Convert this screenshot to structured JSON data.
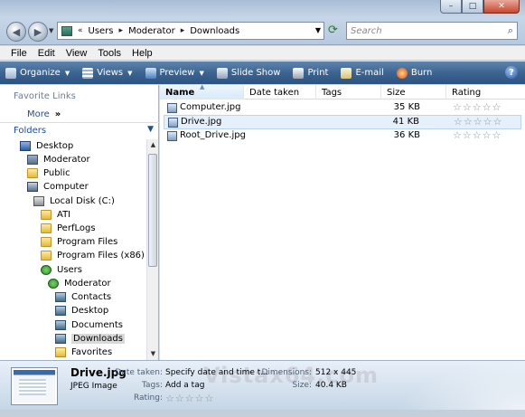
{
  "window": {
    "controls": {
      "minimize": "–",
      "maximize": "□",
      "close": "✕"
    }
  },
  "address": {
    "overflow": "«",
    "crumbs": [
      "Users",
      "Moderator",
      "Downloads"
    ],
    "search_placeholder": "Search"
  },
  "menu": [
    "File",
    "Edit",
    "View",
    "Tools",
    "Help"
  ],
  "toolbar": {
    "organize": "Organize",
    "views": "Views",
    "preview": "Preview",
    "slideshow": "Slide Show",
    "print": "Print",
    "email": "E-mail",
    "burn": "Burn",
    "help": "?"
  },
  "nav": {
    "favorite_links": "Favorite Links",
    "more": "More",
    "folders": "Folders",
    "tree": [
      {
        "label": "Desktop",
        "icon": "desktop-icon"
      },
      {
        "label": "Moderator",
        "icon": "user-folder-icon"
      },
      {
        "label": "Public",
        "icon": "folder-icon"
      },
      {
        "label": "Computer",
        "icon": "computer-icon"
      },
      {
        "label": "Local Disk (C:)",
        "icon": "disk-icon"
      },
      {
        "label": "ATI",
        "icon": "folder-icon"
      },
      {
        "label": "PerfLogs",
        "icon": "folder-icon"
      },
      {
        "label": "Program Files",
        "icon": "folder-icon"
      },
      {
        "label": "Program Files (x86)",
        "icon": "folder-icon"
      },
      {
        "label": "Users",
        "icon": "users-green-icon"
      },
      {
        "label": "Moderator",
        "icon": "user-green-icon"
      },
      {
        "label": "Contacts",
        "icon": "contacts-folder-icon"
      },
      {
        "label": "Desktop",
        "icon": "desktop-folder-icon"
      },
      {
        "label": "Documents",
        "icon": "documents-folder-icon"
      },
      {
        "label": "Downloads",
        "icon": "downloads-folder-icon"
      },
      {
        "label": "Favorites",
        "icon": "favorites-folder-icon"
      }
    ]
  },
  "columns": [
    "Name",
    "Date taken",
    "Tags",
    "Size",
    "Rating"
  ],
  "files": [
    {
      "name": "Computer.jpg",
      "size": "35 KB",
      "rating": 0
    },
    {
      "name": "Drive.jpg",
      "size": "41 KB",
      "rating": 0
    },
    {
      "name": "Root_Drive.jpg",
      "size": "36 KB",
      "rating": 0
    }
  ],
  "details": {
    "name": "Drive.jpg",
    "type": "JPEG Image",
    "date_taken_label": "Date taken:",
    "date_taken_value": "Specify date and time t...",
    "tags_label": "Tags:",
    "tags_value": "Add a tag",
    "rating_label": "Rating:",
    "rating": 0,
    "dimensions_label": "Dimensions:",
    "dimensions_value": "512 x 445",
    "size_label": "Size:",
    "size_value": "40.4 KB",
    "watermark": "Vistax64.com"
  },
  "colors": {
    "accent": "#2c5381",
    "selection": "#e6f0fa",
    "link": "#1e4b9a"
  }
}
